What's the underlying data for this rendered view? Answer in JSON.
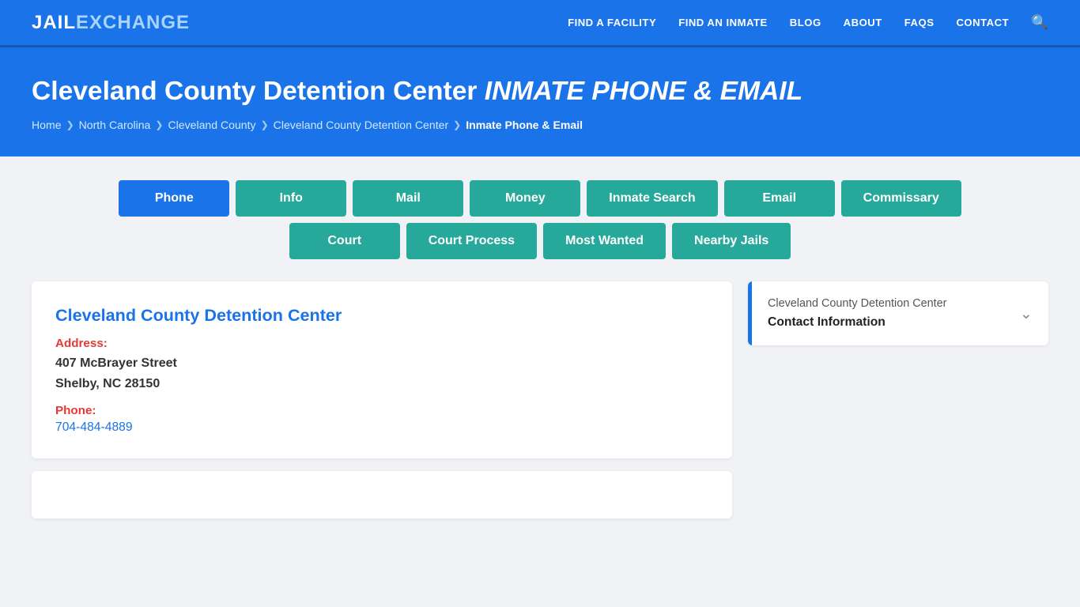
{
  "navbar": {
    "logo_jail": "JAIL",
    "logo_exchange": "EXCHANGE",
    "links": [
      {
        "label": "FIND A FACILITY",
        "href": "#"
      },
      {
        "label": "FIND AN INMATE",
        "href": "#"
      },
      {
        "label": "BLOG",
        "href": "#"
      },
      {
        "label": "ABOUT",
        "href": "#"
      },
      {
        "label": "FAQs",
        "href": "#"
      },
      {
        "label": "CONTACT",
        "href": "#"
      }
    ]
  },
  "hero": {
    "title_main": "Cleveland County Detention Center",
    "title_italic": "INMATE PHONE & EMAIL",
    "breadcrumb": [
      {
        "label": "Home",
        "href": "#"
      },
      {
        "label": "North Carolina",
        "href": "#"
      },
      {
        "label": "Cleveland County",
        "href": "#"
      },
      {
        "label": "Cleveland County Detention Center",
        "href": "#"
      },
      {
        "label": "Inmate Phone & Email",
        "current": true
      }
    ]
  },
  "nav_buttons": {
    "row1": [
      {
        "label": "Phone",
        "active": true
      },
      {
        "label": "Info",
        "active": false
      },
      {
        "label": "Mail",
        "active": false
      },
      {
        "label": "Money",
        "active": false
      },
      {
        "label": "Inmate Search",
        "active": false
      },
      {
        "label": "Email",
        "active": false
      },
      {
        "label": "Commissary",
        "active": false
      }
    ],
    "row2": [
      {
        "label": "Court",
        "active": false
      },
      {
        "label": "Court Process",
        "active": false
      },
      {
        "label": "Most Wanted",
        "active": false
      },
      {
        "label": "Nearby Jails",
        "active": false
      }
    ]
  },
  "info_card": {
    "title": "Cleveland County Detention Center",
    "address_label": "Address:",
    "address_line1": "407 McBrayer Street",
    "address_line2": "Shelby, NC 28150",
    "phone_label": "Phone:",
    "phone_number": "704-484-4889"
  },
  "sidebar": {
    "facility_name": "Cleveland County Detention Center",
    "contact_label": "Contact Information"
  }
}
